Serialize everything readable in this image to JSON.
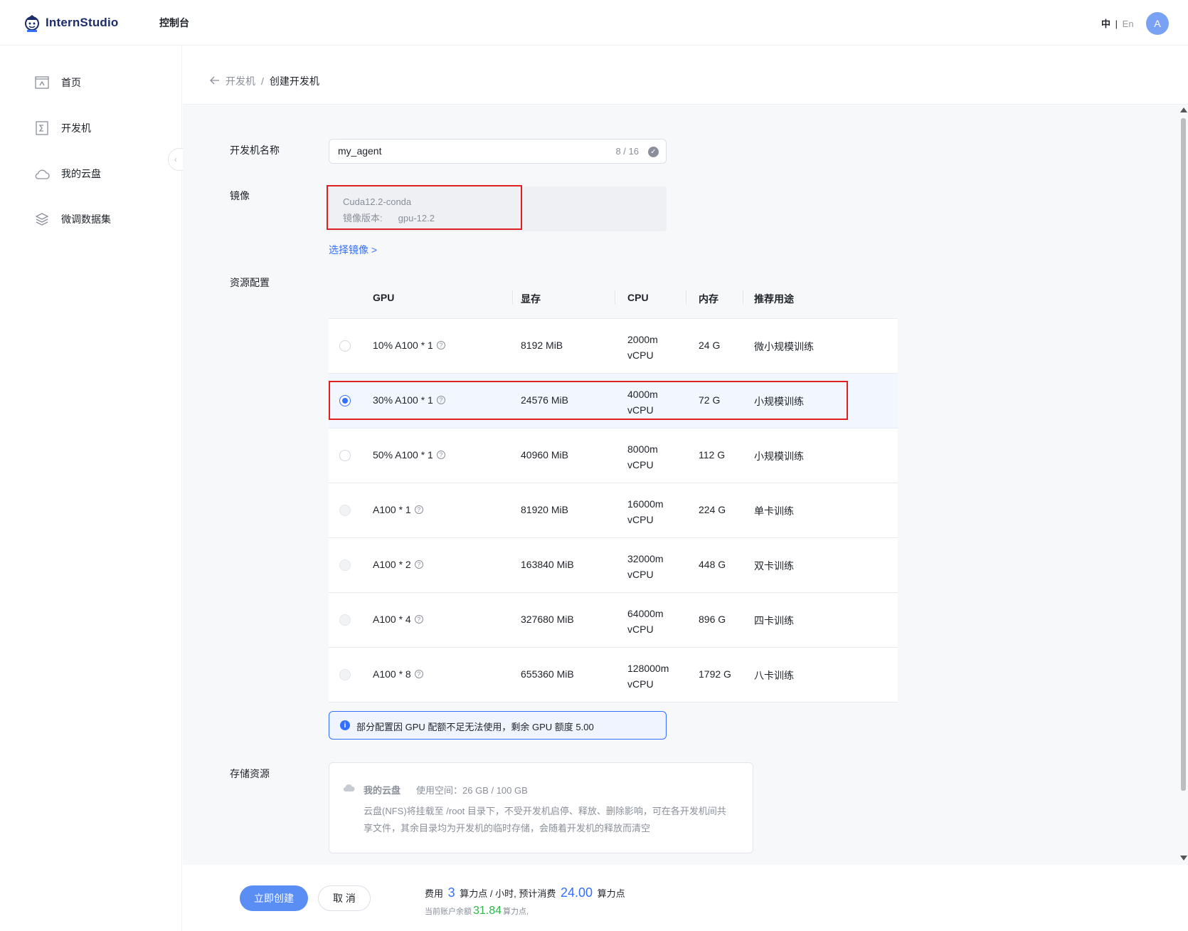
{
  "header": {
    "logo_text": "InternStudio",
    "console": "控制台",
    "lang_zh": "中",
    "lang_sep": "|",
    "lang_en": "En",
    "avatar": "A"
  },
  "sidebar": {
    "items": [
      {
        "label": "首页",
        "icon": "home-icon"
      },
      {
        "label": "开发机",
        "icon": "terminal-icon"
      },
      {
        "label": "我的云盘",
        "icon": "cloud-icon"
      },
      {
        "label": "微调数据集",
        "icon": "layers-icon"
      }
    ]
  },
  "breadcrumb": {
    "back": "开发机",
    "separator": "/",
    "current": "创建开发机"
  },
  "form": {
    "name_label": "开发机名称",
    "name_value": "my_agent",
    "name_counter": "8 / 16",
    "image_label": "镜像",
    "image_name": "Cuda12.2-conda",
    "image_version_label": "镜像版本:",
    "image_version": "gpu-12.2",
    "select_image": "选择镜像 >",
    "resource_label": "资源配置",
    "storage_label": "存储资源"
  },
  "table": {
    "headers": [
      "GPU",
      "显存",
      "CPU",
      "内存",
      "推荐用途"
    ],
    "rows": [
      {
        "gpu": "10% A100 * 1",
        "vram": "8192 MiB",
        "cpu1": "2000m",
        "cpu2": "vCPU",
        "mem": "24 G",
        "use": "微小规模训练",
        "state": "enabled"
      },
      {
        "gpu": "30% A100 * 1",
        "vram": "24576 MiB",
        "cpu1": "4000m",
        "cpu2": "vCPU",
        "mem": "72 G",
        "use": "小规模训练",
        "state": "selected"
      },
      {
        "gpu": "50% A100 * 1",
        "vram": "40960 MiB",
        "cpu1": "8000m",
        "cpu2": "vCPU",
        "mem": "112 G",
        "use": "小规模训练",
        "state": "enabled"
      },
      {
        "gpu": "A100 * 1",
        "vram": "81920 MiB",
        "cpu1": "16000m",
        "cpu2": "vCPU",
        "mem": "224 G",
        "use": "单卡训练",
        "state": "disabled"
      },
      {
        "gpu": "A100 * 2",
        "vram": "163840 MiB",
        "cpu1": "32000m",
        "cpu2": "vCPU",
        "mem": "448 G",
        "use": "双卡训练",
        "state": "disabled"
      },
      {
        "gpu": "A100 * 4",
        "vram": "327680 MiB",
        "cpu1": "64000m",
        "cpu2": "vCPU",
        "mem": "896 G",
        "use": "四卡训练",
        "state": "disabled"
      },
      {
        "gpu": "A100 * 8",
        "vram": "655360 MiB",
        "cpu1": "128000m",
        "cpu2": "vCPU",
        "mem": "1792 G",
        "use": "八卡训练",
        "state": "disabled"
      }
    ]
  },
  "alert": {
    "text": "部分配置因 GPU 配额不足无法使用，剩余 GPU 额度 5.00"
  },
  "storage": {
    "title": "我的云盘",
    "usage": "使用空间：26 GB / 100 GB",
    "desc": "云盘(NFS)将挂载至 /root 目录下，不受开发机启停、释放、删除影响，可在各开发机间共享文件，其余目录均为开发机的临时存储，会随着开发机的释放而清空"
  },
  "footer": {
    "create": "立即创建",
    "cancel": "取 消",
    "fee_prefix": "费用",
    "fee_rate": "3",
    "fee_mid": "算力点 / 小时, 预计消费",
    "fee_total": "24.00",
    "fee_suffix": "算力点",
    "balance_prefix": "当前账户余额",
    "balance": "31.84",
    "balance_suffix": "算力点,"
  },
  "colors": {
    "accent": "#3370ff",
    "highlight": "#e02020",
    "balance": "#2eb84a",
    "button": "#5b8ef5"
  }
}
